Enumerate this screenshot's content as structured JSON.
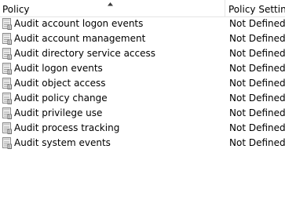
{
  "columns": {
    "policy": "Policy",
    "setting": "Policy Setting",
    "sort_indicator": "sort-ascending-icon"
  },
  "row_icon": "policy-setting-icon",
  "rows": [
    {
      "name": "Audit account logon events",
      "setting": "Not Defined"
    },
    {
      "name": "Audit account management",
      "setting": "Not Defined"
    },
    {
      "name": "Audit directory service access",
      "setting": "Not Defined"
    },
    {
      "name": "Audit logon events",
      "setting": "Not Defined"
    },
    {
      "name": "Audit object access",
      "setting": "Not Defined"
    },
    {
      "name": "Audit policy change",
      "setting": "Not Defined"
    },
    {
      "name": "Audit privilege use",
      "setting": "Not Defined"
    },
    {
      "name": "Audit process tracking",
      "setting": "Not Defined"
    },
    {
      "name": "Audit system events",
      "setting": "Not Defined"
    }
  ]
}
